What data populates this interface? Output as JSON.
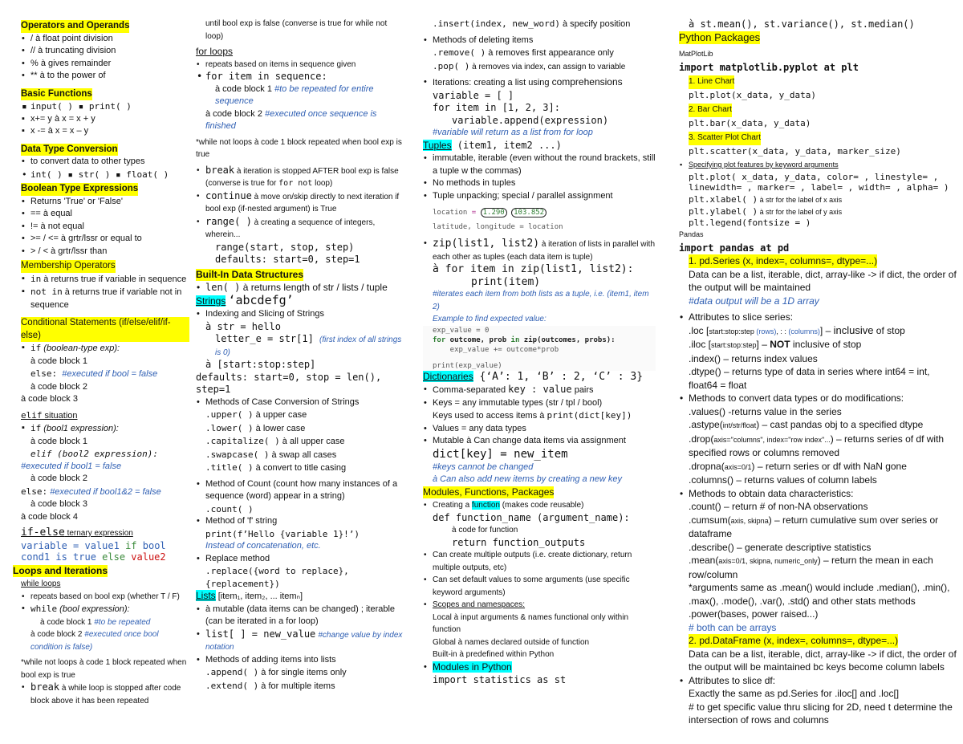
{
  "col1": {
    "operators": {
      "title": "Operators and Operands",
      "items": [
        "/ à float point division",
        "// à truncating division",
        "% à gives remainder",
        "** à to the power of"
      ]
    },
    "basic_functions": {
      "title": "Basic Functions",
      "items": [
        "input( )  ▪ print( )",
        "x+= y à x = x + y",
        "x -= à x = x – y"
      ]
    },
    "conversion": {
      "title": "Data Type Conversion",
      "items": [
        "to convert data to other types",
        "int( ) ▪ str( ) ▪ float( )"
      ]
    },
    "boolean": {
      "title": "Boolean Type Expressions",
      "items": [
        "Returns 'True' or 'False'",
        "== à equal",
        "!= à not equal",
        ">= / <= à grtr/lssr or equal to",
        "> / < à grtr/lssr than"
      ]
    },
    "membership": {
      "title": "Membership Operators",
      "in_code": "in",
      "in_text": " à returns true if variable in sequence",
      "notin_code": "not in",
      "notin_text": " à returns true if variable not in sequence"
    },
    "conditional": {
      "title": "Conditional Statements (if/else/elif/if-else)",
      "if_kw": "if",
      "if_exp": " (boolean-type exp):",
      "cb1": "à code block 1",
      "else_kw": "else:",
      "else_comment": "#executed if bool = false",
      "cb2": "à code block 2",
      "cb3": "à code block 3"
    },
    "elif": {
      "title_code": "elif",
      "title_text": " situation",
      "if_kw": "if",
      "if_exp": " (bool1 expression):",
      "cb1": "à code block 1",
      "elif_line": "elif (bool2 expression):",
      "elif_comment": "#executed if bool1 = false",
      "cb2": "à code block 2",
      "else_kw": "else:",
      "else_comment": "#executed if bool1&2 = false",
      "cb3": "à code block 3",
      "cb4": "à code block 4"
    },
    "ternary": {
      "title_code": "if-else",
      "title_text": " ternary expression",
      "p1": "variable = ",
      "p2": "value1",
      "p3": " if ",
      "p4": "bool cond1 is true",
      "p5": " else ",
      "p6": "value2"
    },
    "loops": {
      "title": "Loops and Iterations",
      "while_title": "while loops",
      "item1": "repeats based on bool exp (whether T / F)",
      "while_kw": "while",
      "while_exp": " (bool expression):",
      "cb1": "à code block 1 ",
      "cb1_comment": "#to be repeated",
      "cb2": "à code block 2 ",
      "cb2_comment": "#executed once bool condition is false)",
      "note": "*while not loops à code 1 block repeated when bool exp is true",
      "break_kw": "break",
      "break_text": " à while loop is stopped after code block above it has been repeated"
    }
  },
  "col2": {
    "cont": "until bool exp is false (converse is true for while not loop)",
    "for_title": "for loops",
    "for_item1": "repeats based on items in sequence given",
    "for_code": "for item in sequence:",
    "cb1": "à code block 1 ",
    "cb1_comment": "#to be repeated for entire sequence",
    "cb2": "à code block 2 ",
    "cb2_comment": "#executed once sequence is finished",
    "note": "*while not loops à code 1 block repeated when bool exp is true",
    "break_kw": "break",
    "break_text": " à iteration is stopped AFTER bool exp is false (converse is true for ",
    "break_code": "for not",
    "break_end": " loop)",
    "continue_kw": "continue",
    "continue_text": " à move on/skip directly to next iteration if bool exp (if-nested argument) is True",
    "range_kw": "range( )",
    "range_text": " à creating a sequence of integers, wherein...",
    "range_sig": "range(start, stop, step)",
    "range_def": "defaults: start=0, step=1",
    "builtin_title": "Built-In Data Structures",
    "len_code": "len( )",
    "len_text": " à returns length of str / lists / tuple",
    "strings_title": "Strings",
    "strings_example": "‘abcdefg’",
    "idx_title": "Indexing and Slicing of Strings",
    "idx_l1": "à str = hello",
    "idx_l2": "letter_e = str[1] ",
    "idx_l2_comment": "(first index of all strings is 0)",
    "idx_l3": "à [start:stop:step]",
    "idx_l4": "defaults: start=0, stop = len(), step=1",
    "case_title": "Methods of Case Conversion of Strings",
    "case_items": [
      {
        "code": ".upper( )",
        "text": " à upper case"
      },
      {
        "code": ".lower( )",
        "text": " à lower case"
      },
      {
        "code": ".capitalize( )",
        "text": " à all upper case"
      },
      {
        "code": ".swapcase( )",
        "text": " à swap all cases"
      },
      {
        "code": ".title( )",
        "text": " à convert to title casing"
      }
    ],
    "count_title": "Method of Count (count how many instances of a sequence (word) appear in a string)",
    "count_code": ".count( )",
    "fstring_title": "Method of 'f' string",
    "fstring_code": "print(f’Hello {variable 1}!’)",
    "fstring_comment": "Instead of concatenation, etc.",
    "replace_title": "Replace method",
    "replace_code": ".replace({word to replace}, {replacement})",
    "lists_title": "Lists",
    "lists_example": " [item₁, item₂, ... itemₙ]",
    "lists_items": [
      "à mutable (data items can be changed) ; iterable (can be iterated in a for loop)"
    ],
    "list_assign_code": "list[ ] = new_value",
    "list_assign_comment": "#change value by index notation",
    "add_title": "Methods of adding items into lists",
    "append": ".append( )",
    "append_text": " à for single items only",
    "extend": ".extend( )",
    "extend_text": " à for multiple items"
  },
  "col3": {
    "insert": ".insert(index, new_word)",
    "insert_text": " à specify position",
    "del_title": "Methods of deleting items",
    "remove": ".remove( )",
    "remove_text": " à removes first appearance only",
    "pop": ".pop( )",
    "pop_text": " à removes via index, can assign to variable",
    "iter_title": "Iterations: creating a list using ",
    "iter_bold": "comprehensions",
    "iter_code": [
      "variable = [ ]",
      "for item in [1, 2, 3]:",
      "    variable.append(expression)"
    ],
    "iter_comment": "#variable will return as a list from for loop",
    "tuples_title": "Tuples",
    "tuples_example": " (item1, item2 ...)",
    "tuple_items": [
      "immutable, iterable (even without the round brackets, still a tuple w the commas)",
      "No methods in tuples",
      "Tuple unpacking; special / parallel assignment"
    ],
    "unpack": {
      "line1_var": "location",
      "line1_eq": " = ",
      "val1": "1.290",
      "val2": "103.852",
      "line2": "latitude, longitude = location"
    },
    "zip_code": "zip(list1, list2)",
    "zip_text": " à iteration of lists in parallel with each other as tuples (each data item is tuple)",
    "zip_for": "à for item in zip(list1, list2):",
    "zip_print": "print(item)",
    "zip_comment": "#iterates each item from both lists as a tuple, i.e. (item1, item 2)",
    "example_title": "Example to find expected value:",
    "example_code": {
      "l1": "exp_value = 0",
      "l2a": "for",
      "l2b": " outcome, prob ",
      "l2c": "in",
      "l2d": " zip(outcomes, probs):",
      "l3": "    exp_value += outcome*prob",
      "l4": "print(exp_value)"
    },
    "dict_title": "Dictionaries",
    "dict_example": " {‘A’: 1, ‘B’ : 2, ‘C’ : 3}",
    "dict_item1_a": "Comma-separated ",
    "dict_item1_code": "key : value",
    "dict_item1_b": " pairs",
    "dict_item2": "Keys = any immutable types (str / tpl / bool)",
    "dict_item2b": "Keys used to access items à ",
    "dict_item2b_code": "print(dict[key])",
    "dict_item3": "Values = any data types",
    "dict_item4": "Mutable à Can change data items via assignment",
    "dict_assign": "dict[key] = new_item",
    "dict_c1": "#keys cannot be changed",
    "dict_c2": "à Can also add new items by creating a new key",
    "mod_title": "Modules, Functions, Packages",
    "func_a": "Creating a ",
    "func_hl": "function",
    "func_b": " (makes code reusable)",
    "func_def": "def function_name (argument_name):",
    "func_code": "à code for function",
    "func_ret": "return function_outputs",
    "mod_items": [
      "Can create multiple outputs (i.e. create dictionary, return multiple outputs, etc)",
      "Can set default values to some arguments (use specific keyword arguments)"
    ],
    "scopes_title": "Scopes and namespaces:",
    "scope_local": "Local à input arguments & names functional only within function",
    "scope_global": "Global à names declared outside of function",
    "scope_builtin": "Built-in à predefined within Python",
    "modules_python": "Modules in Python",
    "import_stats": "import statistics as st"
  },
  "col4": {
    "stats_line": "à st.mean(), st.variance(), st.median()",
    "packages_title": "Python Packages",
    "mpl_label": "MatPlotLib",
    "mpl_import": "import matplotlib.pyplot at plt",
    "charts": [
      {
        "label": "1. Line Chart",
        "code": "plt.plot(x_data, y_data)"
      },
      {
        "label": "2. Bar Chart",
        "code": "plt.bar(x_data, y_data)"
      },
      {
        "label": "3. Scatter Plot Chart",
        "code": "plt.scatter(x_data, y_data, marker_size)"
      }
    ],
    "kw_title": "Specifying plot features by keyword arguments",
    "kw_code": "plt.plot( x_data, y_data, color= , linestyle= , linewidth= , marker= , label= , width= , alpha= )",
    "xlabel": "plt.xlabel( )",
    "xlabel_text": " à str for the label of x axis",
    "ylabel": "plt.ylabel( )",
    "ylabel_text": " à str for the label of y axis",
    "legend": "plt.legend(fontsize = )",
    "pandas_label": "Pandas",
    "pandas_import": "import pandas at pd",
    "series_title": "1. pd.Series (x, index=, columns=, dtype=...)",
    "series_desc": "Data can be a list, iterable, dict, array-like -> if dict, the order of the output will be maintained",
    "series_comment": "#data output will be a 1D array",
    "slice_title": "Attributes to slice series:",
    "loc_a": ".loc [",
    "loc_small": "start:stop:step",
    "loc_rows": " (rows)",
    "loc_sep": ", : : ",
    "loc_cols": "(columns)",
    "loc_b": "] – ",
    "loc_bold": "inclusive",
    "loc_c": " of stop",
    "iloc_a": ".iloc [",
    "iloc_small": "start:stop:step",
    "iloc_b": "] – ",
    "iloc_bold": "NOT",
    "iloc_c": " inclusive of stop",
    "index_line": ".index() – returns index values",
    "dtype_line": ".dtype() – returns type of data in series where int64 = int, float64 = float",
    "conv_title": "Methods to convert data types or do modifications:",
    "values_line": ".values() -returns value in the series",
    "astype_a": ".astype(",
    "astype_small": "int/str/float",
    "astype_b": ") – cast pandas obj to a specified dtype",
    "drop_a": ".drop(",
    "drop_small": "axis=\"columns\", index=\"row index\"...",
    "drop_b": ") – returns series of df with specified rows or columns removed",
    "dropna_a": ".dropna(",
    "dropna_small": "axis=0/1",
    "dropna_b": ") – return series or df with NaN gone",
    "columns_line": ".columns() – returns values of column labels",
    "char_title": "Methods to obtain data characteristics:",
    "count_line": ".count() – return # of non-NA observations",
    "cumsum_a": ".cumsum(",
    "cumsum_small": "axis, skipna",
    "cumsum_b": ") – return cumulative sum over series or dataframe",
    "describe_line": ".describe() – generate descriptive statistics",
    "mean_a": ".mean(",
    "mean_small": "axis=0/1, skipna, numeric_only",
    "mean_b": ") – return the mean in each row/column",
    "args_note": "*arguments same as .mean() would include .median(), .min(), .max(), .mode(), .var(), .std() and other stats methods",
    "power_line": ".power(bases, power raised...)",
    "power_comment": "# both can be arrays",
    "df_title": "2. pd.DataFrame (x, index=, columns=, dtype=...)",
    "df_desc": "Data can be a list, iterable, dict, array-like -> if dict, the order of the output will be maintained bc keys become column labels",
    "df_slice_title": "Attributes to slice df:",
    "df_slice_1": "Exactly the same as pd.Series for .iloc[] and .loc[]",
    "df_slice_2": "# to get specific value thru slicing for 2D, need t determine the intersection of rows and columns"
  }
}
